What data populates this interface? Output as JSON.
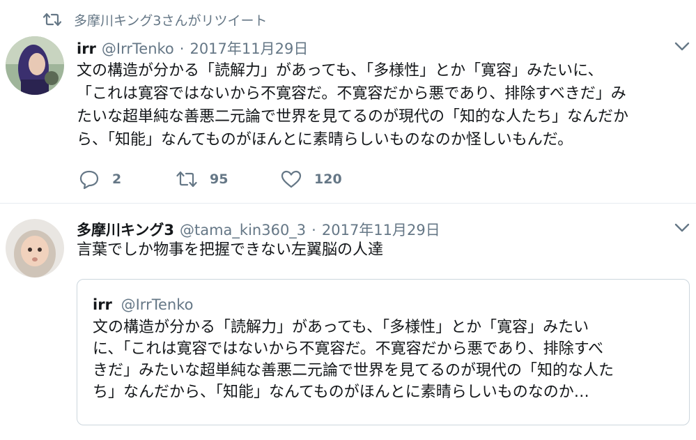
{
  "retweet_notice": {
    "text": "多摩川キング3さんがリツイート",
    "icon": "retweet-icon"
  },
  "tweets": [
    {
      "name": "irr",
      "handle": "@IrrTenko",
      "dot": "·",
      "date": "2017年11月29日",
      "lines": [
        "文の構造が分かる「読解力」があっても、「多様性」とか「寛容」みたいに、",
        "「これは寛容ではないから不寛容だ。不寛容だから悪であり、排除すべきだ」み",
        "たいな超単純な善悪二元論で世界を見てるのが現代の「知的な人たち」なんだか",
        "ら、「知能」なんてものがほんとに素晴らしいものなのか怪しいもんだ。"
      ],
      "actions": {
        "replies": "2",
        "retweets": "95",
        "likes": "120"
      }
    },
    {
      "name": "多摩川キング3",
      "handle": "@tama_kin360_3",
      "dot": "·",
      "date": "2017年11月29日",
      "text": "言葉でしか物事を把握できない左翼脳の人達",
      "quoted": {
        "name": "irr",
        "handle": "@IrrTenko",
        "lines": [
          "文の構造が分かる「読解力」があっても、「多様性」とか「寛容」みたい",
          "に、「これは寛容ではないから不寛容だ。不寛容だから悪であり、排除すべ",
          "きだ」みたいな超単純な善悪二元論で世界を見てるのが現代の「知的な人た",
          "ち」なんだから、「知能」なんてものがほんとに素晴らしいものなのか…"
        ]
      }
    }
  ],
  "colors": {
    "text": "#14171a",
    "secondary": "#657786",
    "border": "#e6ecf0",
    "quote_border": "#ccd6dd"
  }
}
